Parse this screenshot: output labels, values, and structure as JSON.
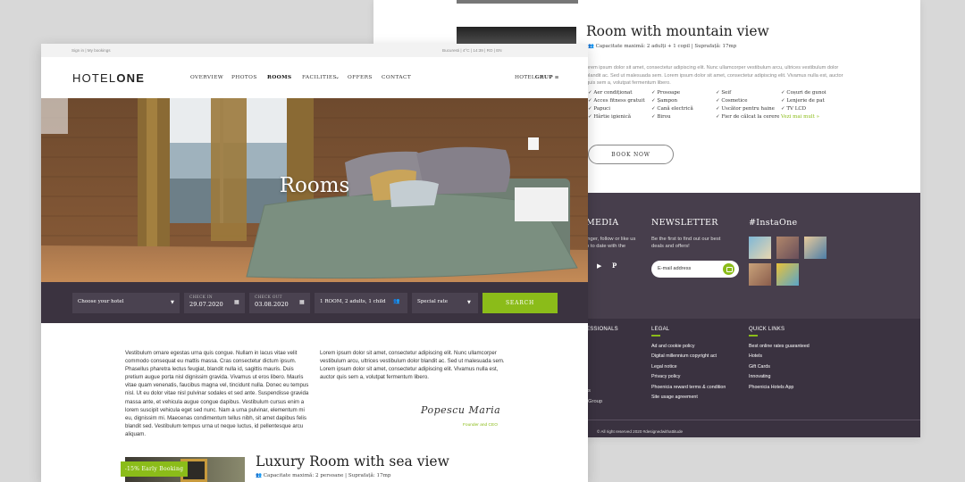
{
  "back": {
    "room_title": "Room with mountain view",
    "room_meta": "Capacitate maximă: 2 adulți + 1 copil  |  Suprafață: 17mp",
    "room_desc": "orem ipsum dolor sit amet, consectetur adipiscing elit. Nunc ullamcorper vestibulum arcu, ultrices vestibulum dolor blandit ac. Sed ut malesuada sem. Lorem ipsum dolor sit amet, consectetur adipiscing elit. Vivamus nulla est, auctor quis sem a, volutpat fermentum libero.",
    "amenities": [
      "Aer condiționat",
      "Prosoape",
      "Seif",
      "Coșuri de gunoi",
      "Acces fitness gratuit",
      "Șampon",
      "Cosmetice",
      "Lenjerie de pat",
      "Papuci",
      "Cană electrică",
      "Uscător pentru haine",
      "TV LCD",
      "Hârtie igienică",
      "Birou",
      "Fier de călcat la cerere"
    ],
    "see_more": "Vezi mai mult »",
    "book_now": "BOOK NOW",
    "media_title": "MEDIA",
    "media_text_1": "inger, follow or like us",
    "media_text_2": "p to date with the",
    "newsletter_title": "NEWSLETTER",
    "newsletter_text_1": "Be the first to find out our best",
    "newsletter_text_2": "deals and offers!",
    "email_placeholder": "E-mail address",
    "insta_title": "#InstaOne",
    "prof_title": "ESSIONALS",
    "prof_frag_1": "s",
    "prof_frag_2": "Group",
    "legal_title": "LEGAL",
    "legal_links": [
      "Ad and cookie policy",
      "Digital millennium copyright act",
      "Legal notice",
      "Privacy policy",
      "Phoenicia reward terms & condition",
      "Site usage agreement"
    ],
    "quick_title": "QUICK LINKS",
    "quick_links": [
      "Best online rates guaranteed",
      "Hotels",
      "Gift Cards",
      "Innovating",
      "Phoenicia Hotels App"
    ],
    "copyright": "© All right reserved 2020   #designedwithattitude"
  },
  "front": {
    "topbar_left": "Sign in   |   My bookings",
    "topbar_right": "Bucuresti   |   4°C   |   14:39   |   RO   |   EN",
    "logo_light": "HOTEL",
    "logo_bold": "ONE",
    "nav": [
      "OVERVIEW",
      "PHOTOS",
      "ROOMS",
      "FACILITIES",
      "OFFERS",
      "CONTACT"
    ],
    "nav_chevron": "⌄",
    "hotelgrup_light": "HOTEL",
    "hotelgrup_bold": "GRUP",
    "menu_icon": "≡",
    "hero_title": "Rooms",
    "booking": {
      "hotel_placeholder": "Choose your hotel",
      "checkin_label": "CHECK IN",
      "checkin_value": "29.07.2020",
      "checkout_label": "CHECK OUT",
      "checkout_value": "03.08.2020",
      "guests_value": "1 ROOM, 2 adults, 1 child",
      "rate_value": "Special rate",
      "search_label": "SEARCH"
    },
    "para_left": "Vestibulum ornare egestas urna quis congue. Nullam in lacus vitae velit commodo consequat eu mattis massa. Cras consectetur dictum ipsum. Phasellus pharetra lectus feugiat, blandit nulla id, sagittis mauris. Duis pretium augue porta nisl dignissim gravida. Vivamus ut eros libero. Mauris vitae quam venenatis, faucibus magna vel, tincidunt nulla. Donec eu tempus nisl. Ut eu dolor vitae nisl pulvinar sodales et sed ante. Suspendisse gravida massa ante, et vehicula augue congue dapibus. Vestibulum cursus enim a lorem suscipit vehicula eget sed nunc. Nam a urna pulvinar, elementum mi eu, dignissim mi. Maecenas condimentum tellus nibh, sit amet dapibus felis blandit sed. Vestibulum tempus urna ut neque luctus, id pellentesque arcu aliquam.",
    "para_right": "Lorem ipsum dolor sit amet, consectetur adipiscing elit. Nunc ullamcorper vestibulum arcu, ultrices vestibulum dolor blandit ac. Sed ut malesuada sem. Lorem ipsum dolor sit amet, consectetur adipiscing elit. Vivamus nulla est, auctor quis sem a, volutpat fermentum libero.",
    "signature": "Popescu Maria",
    "signature_sub": "Founder and CEO",
    "badge": "-15% Early Booking",
    "room_title": "Luxury Room with sea view",
    "room_meta": "Capacitate maximă: 2 persoane  |  Suprafață: 17mp"
  },
  "colors": {
    "accent": "#8bbc19",
    "dark": "#3b3340",
    "dark_alt": "#473e4c"
  }
}
